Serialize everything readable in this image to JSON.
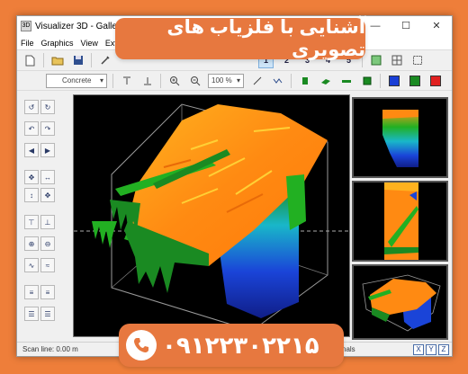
{
  "window": {
    "title": "Visualizer 3D - Galleries ( ...",
    "controls": [
      "—",
      "☐",
      "✕"
    ]
  },
  "menu": [
    "File",
    "Graphics",
    "View",
    "Extr"
  ],
  "toolbar": {
    "view_numbers": [
      "1",
      "2",
      "3",
      "4",
      "5"
    ]
  },
  "toolbar2": {
    "material": "Concrete",
    "zoom": "100 %",
    "swatch_colors": [
      "#1a3fd6",
      "#1a8a22",
      "#e02020"
    ]
  },
  "status": {
    "scan_line": "Scan line: 0.00 m",
    "right_text": "nals",
    "axis_buttons": [
      "X",
      "Y",
      "Z"
    ]
  },
  "overlay": {
    "title": "آشنایی با فلزیاب های تصویری",
    "phone": "۰۹۱۲۲۳۰۲۲۱۵"
  },
  "colors": {
    "background": "#ee7e3a",
    "banner": "#e7783f",
    "scan_high": "#ff9a1a",
    "scan_mid": "#22b022",
    "scan_low": "#1a2fd0"
  }
}
